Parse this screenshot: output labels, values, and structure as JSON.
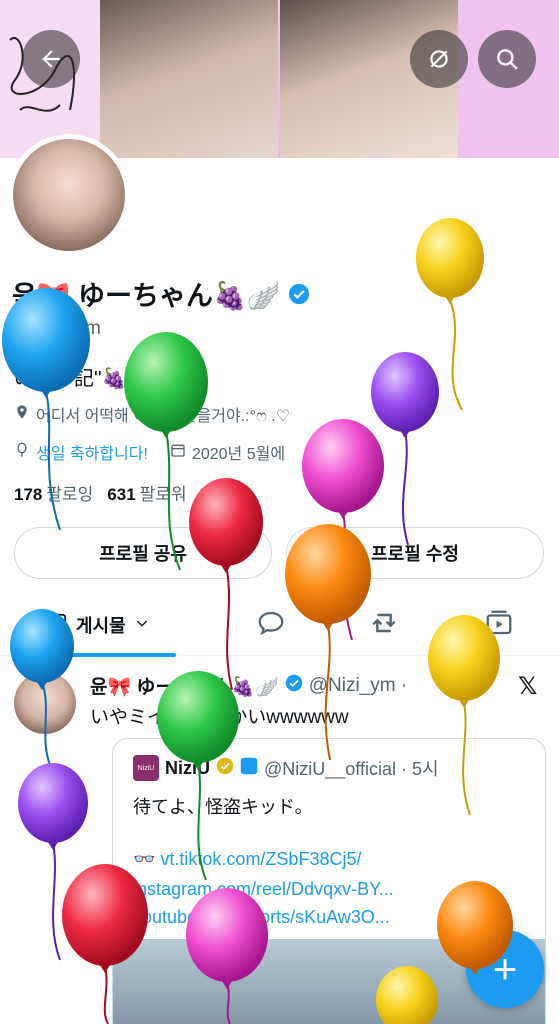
{
  "header": {
    "back_icon": "arrow-left-icon",
    "hide_icon": "eye-slash-icon",
    "search_icon": "search-icon"
  },
  "profile": {
    "name": "윤🎀 ゆーちゃん🍇🪽",
    "handle": "@Nizi_ym",
    "bio": "のミイ記''🍇🖤",
    "location": "어디서 어떡해 이히를 찾을거야.:°ෆ .♡",
    "birthday_link": "생일 축하합니다!",
    "joined": "2020년 5월에",
    "following_count": "178",
    "following_label": "팔로잉",
    "followers_count": "631",
    "followers_label": "팔로워"
  },
  "buttons": {
    "share_profile": "프로필 공유",
    "edit_profile": "프로필 수정"
  },
  "tabs": {
    "posts_label": "게시물"
  },
  "post": {
    "author_name": "윤🎀 ゆーちゃん🍇🪽",
    "author_handle": "@Nizi_ym ·",
    "text": "いやミイ ドなんかいwwwwww",
    "quote": {
      "logo_text": "NiziU",
      "name": "NiziU",
      "handle": "@NiziU__official · 5시",
      "line1": "待てよ、怪盗キッド。",
      "line2": "👓 vt.tiktok.com/ZSbF38Cj5/",
      "line3": "instagram.com/reel/Ddvqxv-BY...",
      "line4": "youtube.com/shorts/sKuAw3O..."
    }
  },
  "colors": {
    "accent": "#1d9bf0",
    "banner": "#efc6ee"
  }
}
